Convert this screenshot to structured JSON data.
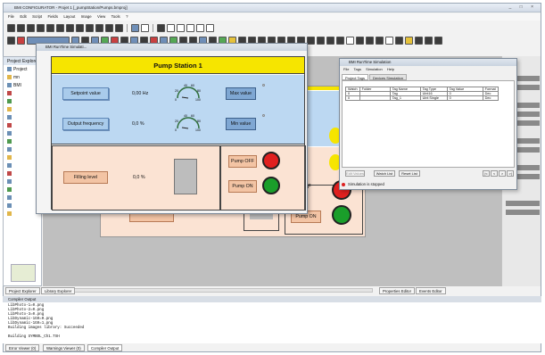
{
  "ide": {
    "title": "BMI CONFIGURATOR - Projet 1 [_pumpStation/Pumps.bmproj]",
    "window_controls": "_ □ ×",
    "menu": [
      "File",
      "Edit",
      "Script",
      "Fields",
      "Layout",
      "Image",
      "View",
      "Tools",
      "?"
    ]
  },
  "tree": {
    "rows": [
      "Project",
      "mn",
      "BMI",
      "",
      "",
      "",
      "",
      "",
      "",
      "",
      "",
      "",
      "",
      "",
      "",
      "",
      "",
      "",
      "",
      "",
      ""
    ],
    "title": "Project Explorer"
  },
  "pump_window": {
    "title": "BMI RunTime Simulati...",
    "header": "Pump Station 1",
    "setpoint_label": "Setpoint value",
    "setpoint_value": "0,00 Hz",
    "output_label": "Output frequency",
    "output_value": "0,0 %",
    "max_label": "Max value",
    "min_label": "Min value",
    "filling_label": "Filling level",
    "filling_value": "0,0 %",
    "pump_off_label": "Pump OFF",
    "pump_on_label": "Pump ON",
    "gauge1_ticks": [
      "40",
      "60",
      "20",
      "80",
      "0",
      "100"
    ],
    "gauge2_ticks": [
      "40",
      "60",
      "20",
      "80",
      "0",
      "100"
    ],
    "back_pump_on": "Pump ON",
    "back_f": "F"
  },
  "sim_window": {
    "title": "BMI RunTime Simulation",
    "menu": [
      "File",
      "Tags",
      "Simulation",
      "Help"
    ],
    "tabs": [
      "Project Tags",
      "Devices Simulation"
    ],
    "columns": [
      "Watch",
      "Folder",
      "Tag Name",
      "Tag Type",
      "Tag Value",
      "Format"
    ],
    "rows": [
      [
        "0",
        "",
        "Tag",
        "Uint16",
        "0",
        "Dec"
      ],
      [
        "0",
        "",
        "Tag_1",
        "Uint Single",
        "0",
        "Dec"
      ]
    ],
    "buttons": [
      "Edit Values",
      "Watch List",
      "Reset List"
    ],
    "nav": [
      "|<",
      "<",
      ">",
      ">|"
    ],
    "status": "Simulation is stopped"
  },
  "bottom": {
    "left_tabs": [
      "Project Explorer",
      "Library Explorer"
    ],
    "right_tabs": [
      "Properties Editor",
      "Events Editor"
    ],
    "output_title": "Compiler Output",
    "output_lines": [
      "LibPhoto-1=0.png",
      "LibPhoto-2=0.png",
      "LibPhoto-3=0.png",
      "LibDynamic-1G0=0.png",
      "LibDynamic-1G0=1.png",
      "Building images library: Succeeded",
      "",
      "Building SYMBOL_Ch1.TXH"
    ],
    "output_tabs": [
      "Error Viewer (0)",
      "Warnings Viewer (0)",
      "Compiler Output"
    ]
  }
}
